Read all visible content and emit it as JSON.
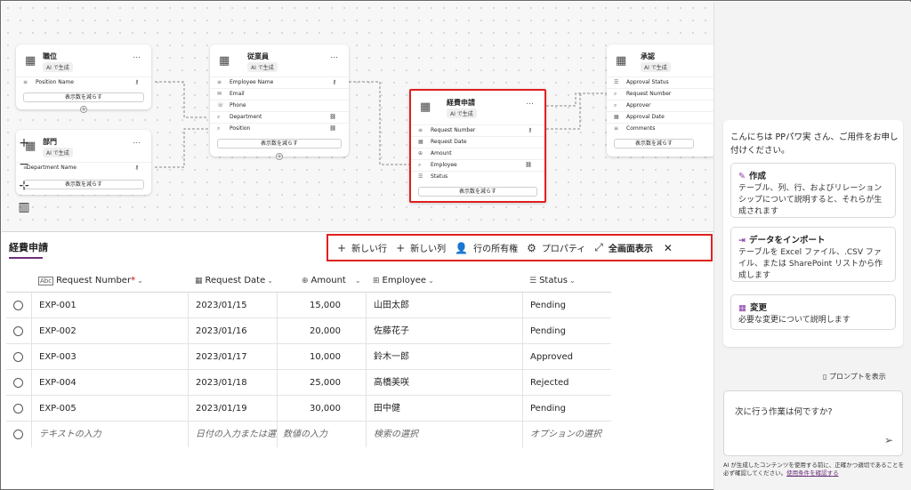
{
  "canvas": {
    "tables": [
      {
        "name": "職位",
        "ai": "AI で生成",
        "fields": [
          {
            "label": "Position Name",
            "icon": "≡",
            "key": true
          }
        ],
        "reduce": "表示数を減らす"
      },
      {
        "name": "部門",
        "ai": "AI で生成",
        "fields": [
          {
            "label": "Department Name",
            "icon": "≡",
            "key": true
          }
        ],
        "reduce": "表示数を減らす"
      },
      {
        "name": "従業員",
        "ai": "AI で生成",
        "fields": [
          {
            "label": "Employee Name",
            "icon": "≡",
            "key": true
          },
          {
            "label": "Email",
            "icon": "✉"
          },
          {
            "label": "Phone",
            "icon": "☏"
          },
          {
            "label": "Department",
            "icon": "⌕",
            "rel": true
          },
          {
            "label": "Position",
            "icon": "⌕",
            "rel": true
          }
        ],
        "reduce": "表示数を減らす"
      },
      {
        "name": "経費申請",
        "ai": "AI で生成",
        "fields": [
          {
            "label": "Request Number",
            "icon": "≡",
            "key": true
          },
          {
            "label": "Request Date",
            "icon": "▦"
          },
          {
            "label": "Amount",
            "icon": "⊕"
          },
          {
            "label": "Employee",
            "icon": "⌕",
            "rel": true
          },
          {
            "label": "Status",
            "icon": "☰"
          }
        ],
        "reduce": "表示数を減らす"
      },
      {
        "name": "承認",
        "ai": "AI で生成",
        "fields": [
          {
            "label": "Approval Status",
            "icon": "☰"
          },
          {
            "label": "Request Number",
            "icon": "⌕"
          },
          {
            "label": "Approver",
            "icon": "⌕"
          },
          {
            "label": "Approval Date",
            "icon": "▦"
          },
          {
            "label": "Comments",
            "icon": "≡"
          }
        ],
        "reduce": "表示数を減らす"
      }
    ],
    "more": "..."
  },
  "table": {
    "title": "経費申請",
    "toolbar": {
      "new_row": "新しい行",
      "new_col": "新しい列",
      "owner": "行の所有権",
      "props": "プロパティ",
      "fullscreen": "全画面表示"
    },
    "columns": [
      {
        "label": "Request Number",
        "required": "*",
        "icon": "Abc"
      },
      {
        "label": "Request Date",
        "icon": "▦"
      },
      {
        "label": "Amount",
        "icon": "⊕"
      },
      {
        "label": "Employee",
        "icon": "⊞"
      },
      {
        "label": "Status",
        "icon": "☰"
      }
    ],
    "rows": [
      [
        "EXP-001",
        "2023/01/15",
        "15,000",
        "山田太郎",
        "Pending"
      ],
      [
        "EXP-002",
        "2023/01/16",
        "20,000",
        "佐藤花子",
        "Pending"
      ],
      [
        "EXP-003",
        "2023/01/17",
        "10,000",
        "鈴木一郎",
        "Approved"
      ],
      [
        "EXP-004",
        "2023/01/18",
        "25,000",
        "高橋美咲",
        "Rejected"
      ],
      [
        "EXP-005",
        "2023/01/19",
        "30,000",
        "田中健",
        "Pending"
      ]
    ],
    "placeholders": [
      "テキストの入力",
      "日付の入力または選択",
      "数値の入力",
      "検索の選択",
      "オプションの選択"
    ]
  },
  "copilot": {
    "greeting": "こんにちは PPパワ実 さん、ご用件をお申し付けください。",
    "suggestions": [
      {
        "title": "作成",
        "desc": "テーブル、列、行、およびリレーションシップについて説明すると、それらが生成されます"
      },
      {
        "title": "データをインポート",
        "desc": "テーブルを Excel ファイル、.CSV ファイル、または SharePoint リストから作成します"
      },
      {
        "title": "変更",
        "desc": "必要な変更について説明します"
      }
    ],
    "prompt_link": "プロンプトを表示",
    "input_placeholder": "次に行う作業は何ですか?",
    "disclaimer": "AI が生成したコンテンツを使用する前に、正確かつ適切であることを必ず確認してください。",
    "terms": "使用条件を確認する"
  },
  "colors": {
    "accent": "#6b2f7a",
    "highlight": "#e02020"
  }
}
